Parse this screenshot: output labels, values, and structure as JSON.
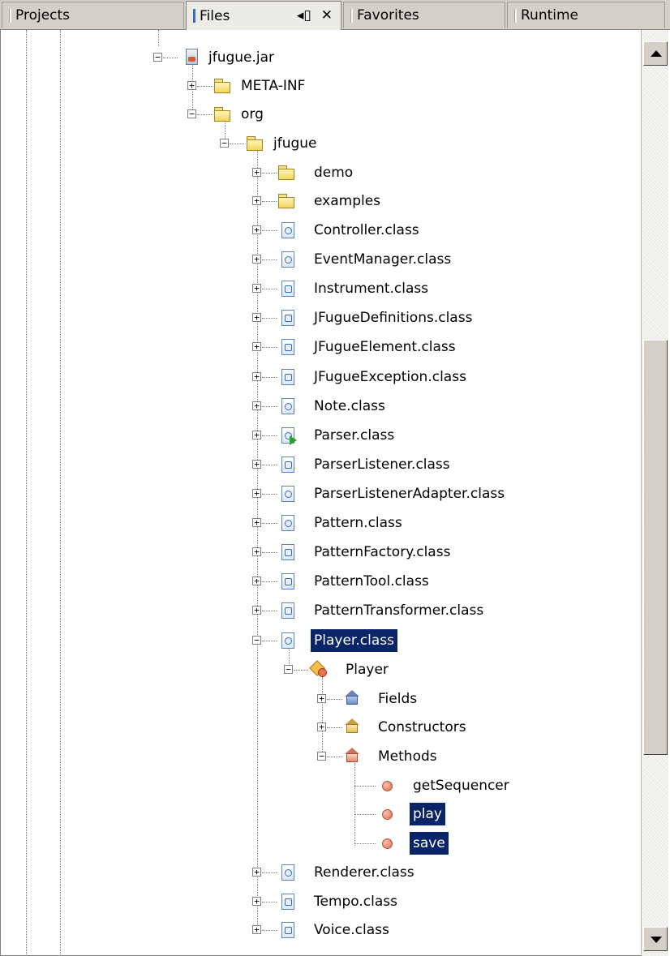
{
  "tabs": [
    {
      "label": "Projects",
      "active": false
    },
    {
      "label": "Files",
      "active": true
    },
    {
      "label": "Favorites",
      "active": false
    },
    {
      "label": "Runtime",
      "active": false
    }
  ],
  "tab_controls": {
    "dock_glyph": "◂▯",
    "close_glyph": "✕"
  },
  "tree": {
    "jar": {
      "label": "jfugue.jar",
      "icon": "jar-icon"
    },
    "meta_inf": {
      "label": "META-INF",
      "icon": "folder-icon"
    },
    "org": {
      "label": "org",
      "icon": "open-folder-icon"
    },
    "jfugue": {
      "label": "jfugue",
      "icon": "open-folder-icon"
    },
    "demo": {
      "label": "demo",
      "icon": "folder-icon"
    },
    "examples": {
      "label": "examples",
      "icon": "folder-icon"
    },
    "classes": [
      {
        "label": "Controller.class",
        "icon": "class-file-icon"
      },
      {
        "label": "EventManager.class",
        "icon": "class-file-icon"
      },
      {
        "label": "Instrument.class",
        "icon": "interface-file-icon"
      },
      {
        "label": "JFugueDefinitions.class",
        "icon": "interface-file-icon"
      },
      {
        "label": "JFugueElement.class",
        "icon": "interface-file-icon"
      },
      {
        "label": "JFugueException.class",
        "icon": "interface-file-icon"
      },
      {
        "label": "Note.class",
        "icon": "class-file-icon"
      },
      {
        "label": "Parser.class",
        "icon": "runnable-class-icon"
      },
      {
        "label": "ParserListener.class",
        "icon": "interface-file-icon"
      },
      {
        "label": "ParserListenerAdapter.class",
        "icon": "class-file-icon"
      },
      {
        "label": "Pattern.class",
        "icon": "class-file-icon"
      },
      {
        "label": "PatternFactory.class",
        "icon": "interface-file-icon"
      },
      {
        "label": "PatternTool.class",
        "icon": "interface-file-icon"
      },
      {
        "label": "PatternTransformer.class",
        "icon": "interface-file-icon"
      }
    ],
    "player_class": {
      "label": "Player.class",
      "selected": true
    },
    "player_type": {
      "label": "Player",
      "icon": "class-type-icon"
    },
    "groups": [
      {
        "label": "Fields",
        "icon": "fields-icon"
      },
      {
        "label": "Constructors",
        "icon": "constructors-icon"
      },
      {
        "label": "Methods",
        "icon": "methods-icon"
      }
    ],
    "methods": [
      {
        "label": "getSequencer",
        "selected": false
      },
      {
        "label": "play",
        "selected": true
      },
      {
        "label": "save",
        "selected": true
      }
    ],
    "trailing_classes": [
      {
        "label": "Renderer.class",
        "icon": "class-file-icon"
      },
      {
        "label": "Tempo.class",
        "icon": "interface-file-icon"
      },
      {
        "label": "Voice.class",
        "icon": "interface-file-icon"
      }
    ]
  },
  "colors": {
    "selection": "#0a246a",
    "tab_bg": "#d4d0c8",
    "active_tab_accent": "#3c6fc4"
  }
}
